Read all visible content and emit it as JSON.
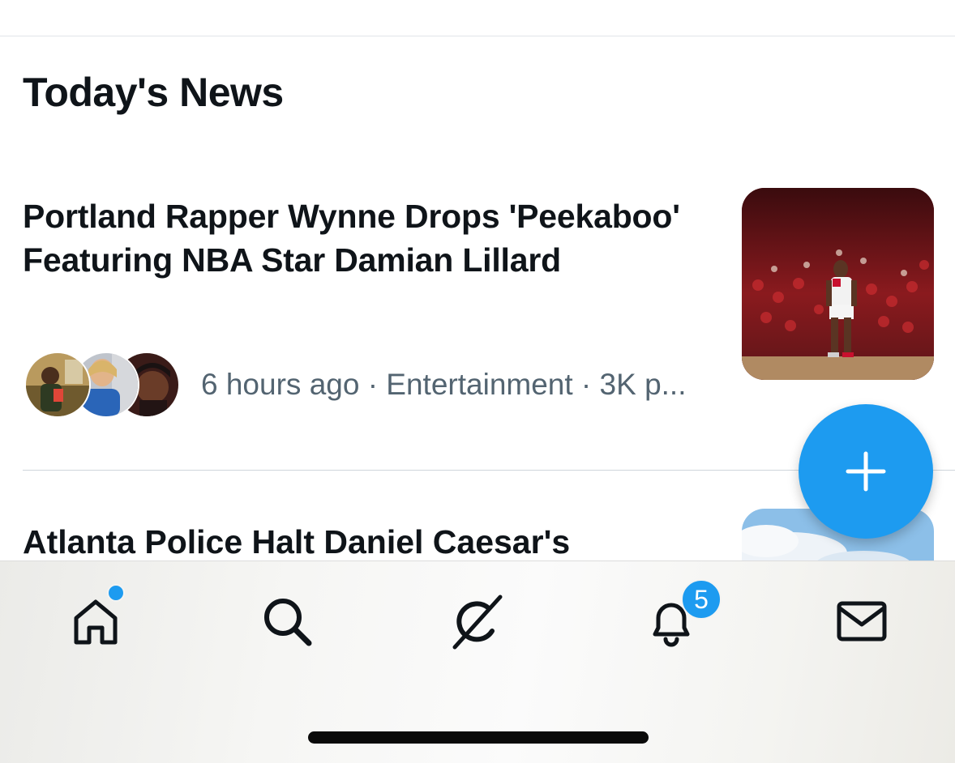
{
  "section": {
    "title": "Today's News"
  },
  "stories": [
    {
      "headline": "Portland Rapper Wynne Drops 'Peekaboo' Featuring NBA Star Damian Lillard",
      "meta": "6 hours ago · Entertainment · 3K p..."
    },
    {
      "headline": "Atlanta Police Halt Daniel Caesar's"
    }
  ],
  "fab": {
    "icon": "plus-icon"
  },
  "tab_bar": {
    "tabs": [
      "home-icon",
      "search-icon",
      "grok-icon",
      "bell-icon",
      "mail-icon"
    ],
    "notification_count": "5"
  },
  "colors": {
    "accent": "#1d9bf0",
    "text": "#0f1419",
    "secondary_text": "#536471"
  }
}
